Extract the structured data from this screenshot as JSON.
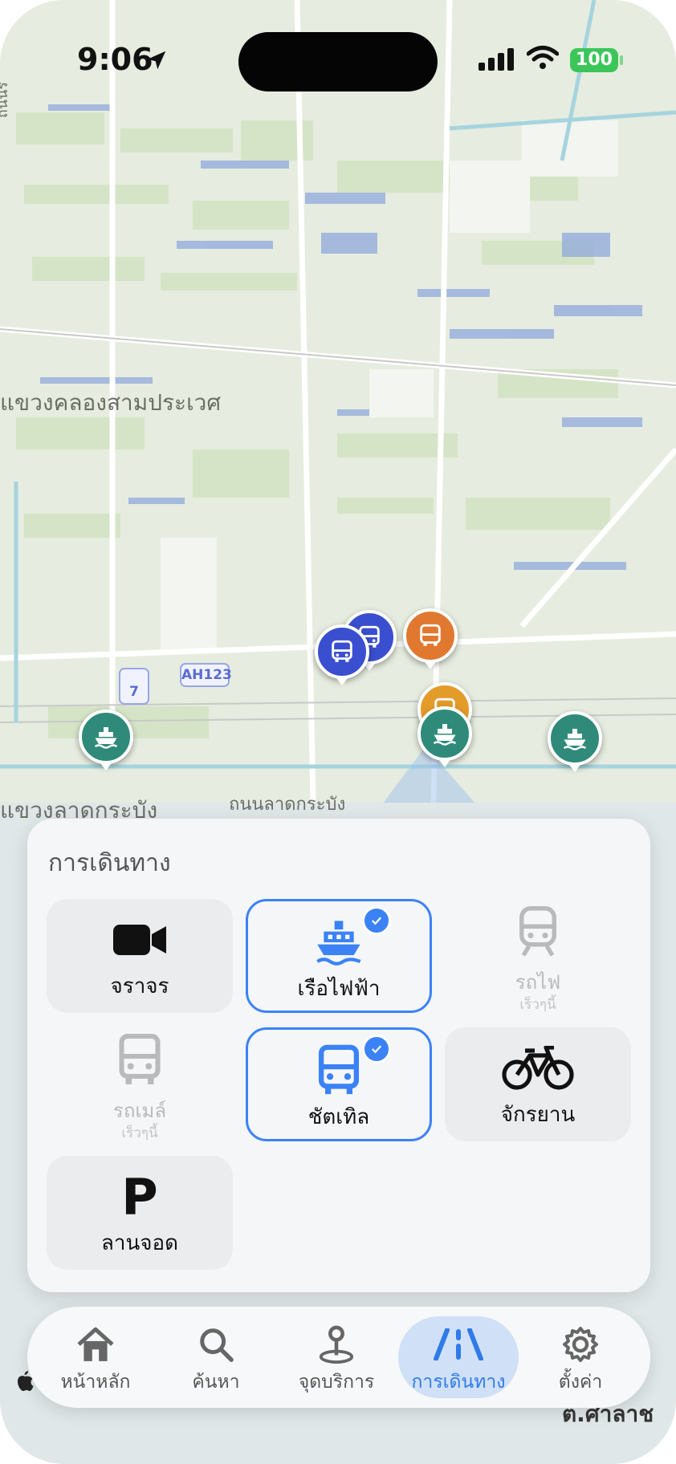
{
  "status_bar": {
    "time": "9:06",
    "battery": "100"
  },
  "map": {
    "labels": {
      "road_vertical": "ถนนร",
      "district_1": "แขวงคลองสามประเวศ",
      "district_2": "แขวงลาดกระบัง",
      "road_1": "ถนนลาดกระบัง",
      "road_shield": "AH123",
      "route_shield": "7",
      "corner": "ต.ศาลาช"
    }
  },
  "panel": {
    "title": "การเดินทาง",
    "tiles": [
      {
        "label": "จราจร",
        "icon": "video-camera-icon",
        "state": "normal"
      },
      {
        "label": "เรือไฟฟ้า",
        "icon": "ferry-icon",
        "state": "selected"
      },
      {
        "label": "รถไฟ",
        "sub": "เร็วๆนี้",
        "icon": "train-icon",
        "state": "disabled"
      },
      {
        "label": "รถเมล์",
        "sub": "เร็วๆนี้",
        "icon": "bus-icon",
        "state": "disabled"
      },
      {
        "label": "ชัตเทิล",
        "icon": "shuttle-bus-icon",
        "state": "selected"
      },
      {
        "label": "จักรยาน",
        "icon": "bicycle-icon",
        "state": "normal"
      },
      {
        "label": "ลานจอด",
        "icon": "parking-icon",
        "state": "normal",
        "glyph": "P"
      }
    ]
  },
  "tabbar": {
    "tabs": [
      {
        "label": "หน้าหลัก",
        "icon": "home-icon"
      },
      {
        "label": "ค้นหา",
        "icon": "search-icon"
      },
      {
        "label": "จุดบริการ",
        "icon": "map-pin-icon"
      },
      {
        "label": "การเดินทาง",
        "icon": "road-icon",
        "active": true
      },
      {
        "label": "ตั้งค่า",
        "icon": "gear-icon"
      }
    ]
  },
  "colors": {
    "accent": "#3b82f6",
    "active_tab_bg": "#cfe0f7",
    "bus_pin": "#3a4fcf",
    "shuttle_pin": "#e0792f",
    "ferry_pin": "#2f8a7a"
  }
}
